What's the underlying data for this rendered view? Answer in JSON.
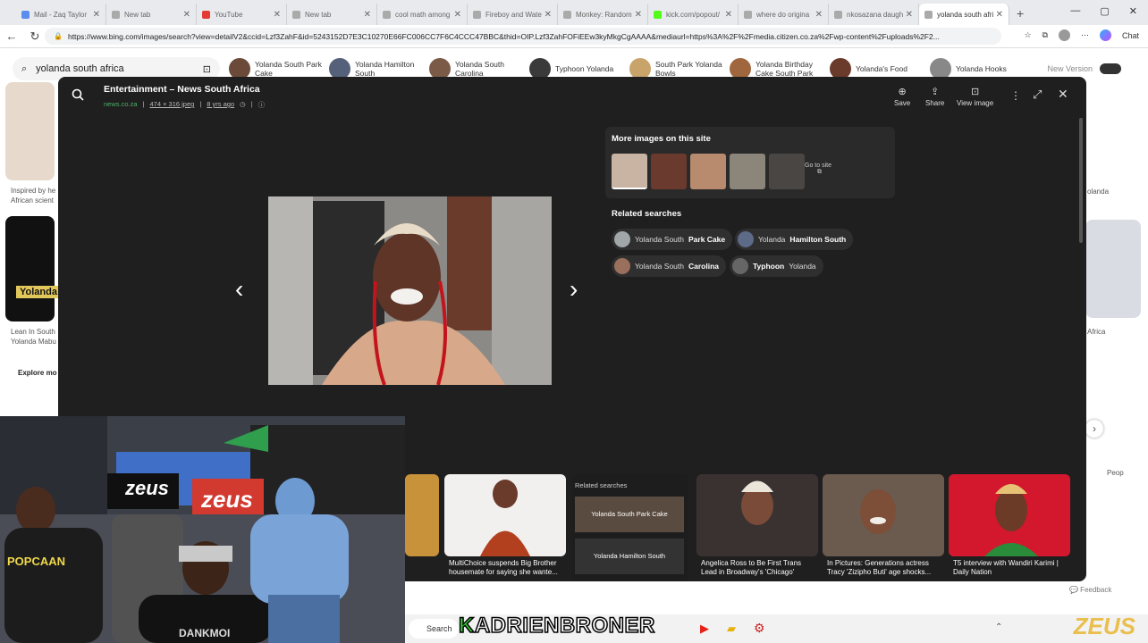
{
  "tabs": [
    {
      "label": "Mail - Zaq Taylor",
      "color": "#5b8def"
    },
    {
      "label": "New tab",
      "color": "#aaa"
    },
    {
      "label": "YouTube",
      "color": "#e53935"
    },
    {
      "label": "New tab",
      "color": "#aaa"
    },
    {
      "label": "cool math among",
      "color": "#aaa"
    },
    {
      "label": "Fireboy and Wate",
      "color": "#aaa"
    },
    {
      "label": "Monkey: Random",
      "color": "#aaa"
    },
    {
      "label": "kick.com/popout/",
      "color": "#53fc18"
    },
    {
      "label": "where do origina",
      "color": "#aaa"
    },
    {
      "label": "nkosazana daugh",
      "color": "#aaa"
    },
    {
      "label": "yolanda south afri",
      "color": "#aaa",
      "active": true
    }
  ],
  "address": {
    "url": "https://www.bing.com/images/search?view=detailV2&ccid=Lzf3ZahF&id=5243152D7E3C10270E66FC006CC7F6C4CCC47BBC&thid=OIP.Lzf3ZahFOFiEEw3kyMkgCgAAAA&mediaurl=https%3A%2F%2Fmedia.citizen.co.za%2Fwp-content%2Fuploads%2F2...",
    "chat": "Chat"
  },
  "search": {
    "query": "yolanda south africa"
  },
  "chips": [
    {
      "label": "Yolanda South Park Cake"
    },
    {
      "label": "Yolanda Hamilton South"
    },
    {
      "label": "Yolanda South Carolina"
    },
    {
      "label": "Typhoon Yolanda"
    },
    {
      "label": "South Park Yolanda Bowls"
    },
    {
      "label": "Yolanda Birthday Cake South Park"
    },
    {
      "label": "Yolanda's Food"
    },
    {
      "label": "Yolanda Hooks"
    }
  ],
  "new_version": "New Version",
  "modal": {
    "title": "Entertainment – News South Africa",
    "source": "news.co.za",
    "size": "474 × 316 jpeg",
    "age": "8 yrs ago",
    "actions": {
      "save": "Save",
      "share": "Share",
      "view_image": "View image"
    },
    "more_title": "More images on this site",
    "go_to_site": "Go to site",
    "related_title": "Related searches",
    "related": [
      {
        "plain": "Yolanda South",
        "bold": "Park Cake"
      },
      {
        "plain": "Yolanda",
        "bold": "Hamilton South"
      },
      {
        "plain": "Yolanda South",
        "bold": "Carolina"
      },
      {
        "plain": "",
        "bold": "Typhoon",
        "after": "Yolanda"
      }
    ]
  },
  "background": {
    "left_caption_1": "Inspired by he African scient",
    "left_caption_2": "Lean In South Yolanda Mabu",
    "yolanda_tag": "Yolanda",
    "explore": "Explore mo",
    "right_caption": "olanda",
    "right_caption_2": "Africa",
    "right_people": "Peop"
  },
  "bottom_cards": [
    {
      "caption": "MultiChoice suspends Big Brother housemate for saying she wante..."
    },
    {
      "caption": "Related searches",
      "sub1": "Yolanda South Park Cake",
      "sub2": "Yolanda Hamilton South"
    },
    {
      "caption": "Angelica Ross to Be First Trans Lead in Broadway's 'Chicago'"
    },
    {
      "caption": "In Pictures: Generations actress Tracy 'Zizipho Buti' age shocks..."
    },
    {
      "caption": "T5 interview with Wandiri Karimi | Daily Nation"
    }
  ],
  "taskbar": {
    "search": "Search"
  },
  "overlay": {
    "name_first": "K",
    "name_rest": "ADRIENBRONER",
    "brand": "ZEUS"
  },
  "webcam": {
    "shirt_text": "POPCAAN",
    "zeus_sign": "zeus",
    "zeus_sign_2": "zeus",
    "shirt2": "DANKMOI"
  }
}
